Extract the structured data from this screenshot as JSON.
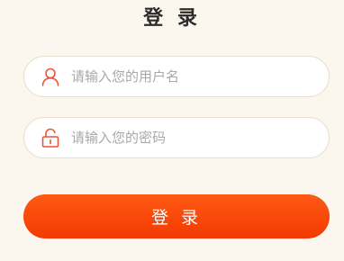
{
  "page": {
    "title": "登 录"
  },
  "username": {
    "placeholder": "请输入您的用户名",
    "value": "",
    "icon": "user-icon"
  },
  "password": {
    "placeholder": "请输入您的密码",
    "value": "",
    "icon": "lock-icon"
  },
  "login_button": {
    "label": "登 录"
  },
  "colors": {
    "background": "#fbf6ee",
    "accent": "#f23a00",
    "icon": "#e8543a",
    "placeholder": "#a8a8a8"
  }
}
